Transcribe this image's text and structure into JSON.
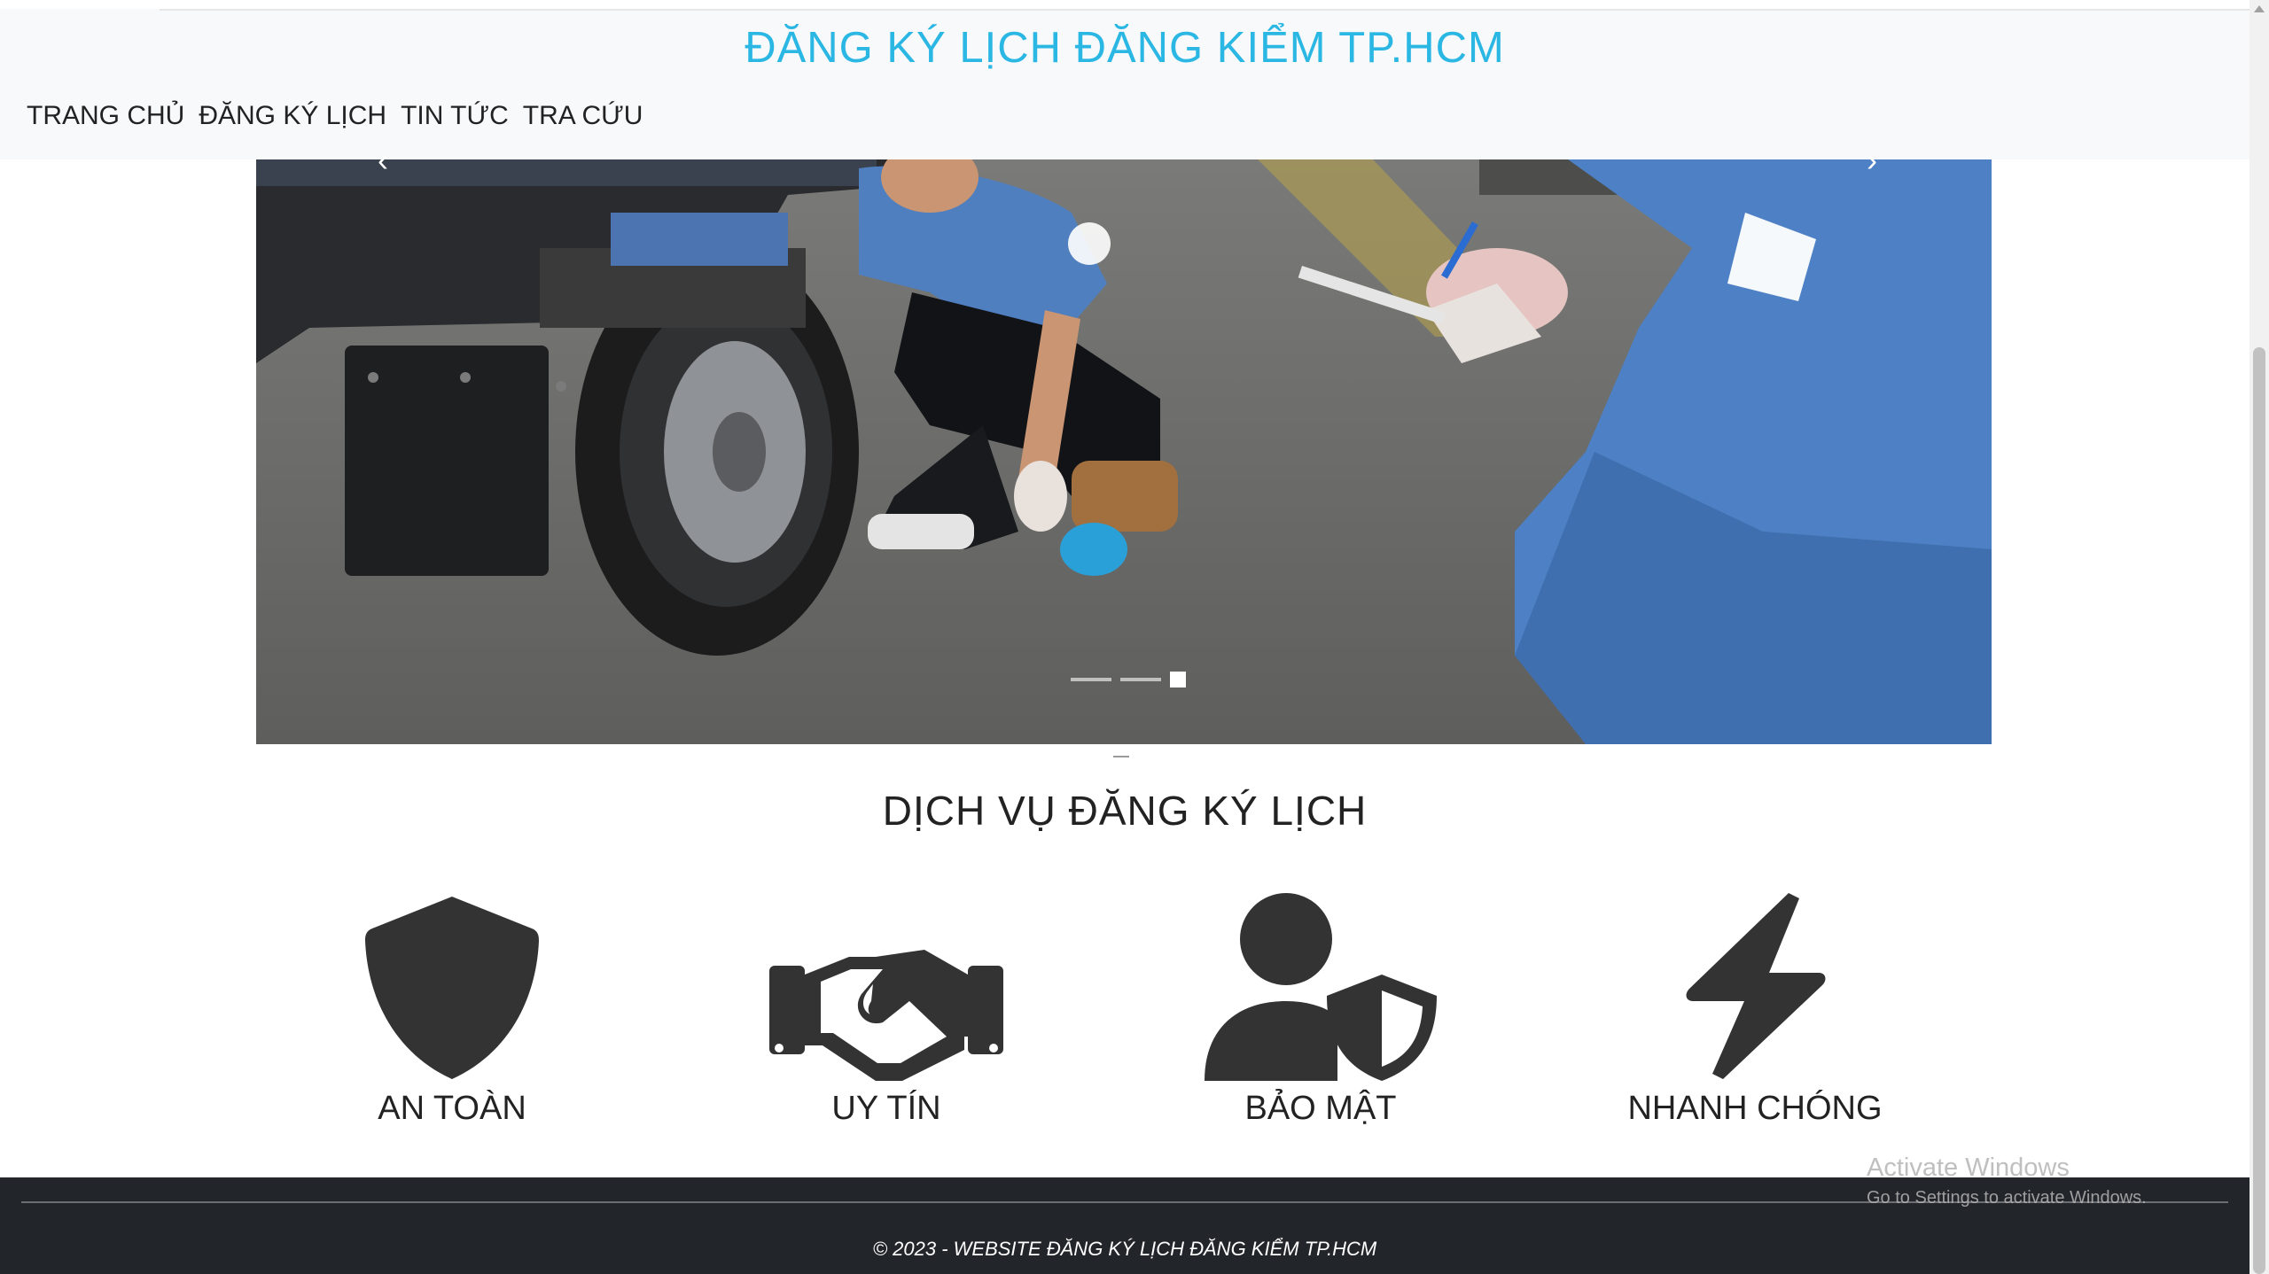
{
  "header": {
    "title": "ĐĂNG KÝ LỊCH ĐĂNG KIỂM TP.HCM",
    "nav": [
      "TRANG CHỦ",
      "ĐĂNG KÝ LỊCH",
      "TIN TỨC",
      "TRA CỨU"
    ]
  },
  "carousel": {
    "prev": "‹",
    "next": "›",
    "slide_count": 3,
    "active_slide": 3
  },
  "services": {
    "title": "DỊCH VỤ ĐĂNG KÝ LỊCH",
    "items": [
      {
        "label": "AN TOÀN",
        "icon": "shield-icon"
      },
      {
        "label": "UY TÍN",
        "icon": "handshake-icon"
      },
      {
        "label": "BẢO MẬT",
        "icon": "user-shield-icon"
      },
      {
        "label": "NHANH CHÓNG",
        "icon": "bolt-icon"
      }
    ]
  },
  "footer": {
    "copyright": "© 2023 - WEBSITE ĐĂNG KÝ LỊCH ĐĂNG KIỂM TP.HCM"
  },
  "watermark": {
    "line1": "Activate Windows",
    "line2": "Go to Settings to activate Windows."
  },
  "colors": {
    "title": "#2bb7e3",
    "footer_bg": "#22252a",
    "icon": "#333333"
  }
}
